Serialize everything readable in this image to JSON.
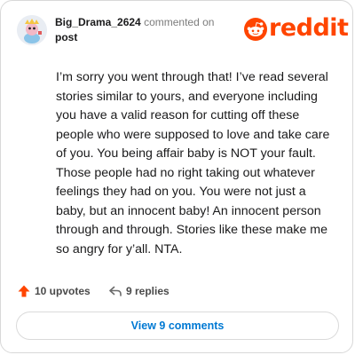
{
  "comment": {
    "username": "Big_Drama_2624",
    "action_text": "commented on",
    "post_type": "post",
    "body": "I’m sorry you went through that! I’ve read several\nstories similar to yours, and everyone including\nyou have a valid reason for cutting off these\npeople who were supposed to love and take care\nof you. You being affair baby is NOT your fault.\nThose people had no right taking out whatever\nfeelings they had on you. You were not just a\nbaby, but an innocent baby! An innocent person\nthrough and through. Stories like these make me\nso angry for y’all. NTA."
  },
  "brand": {
    "name": "reddit",
    "color": "#ff4500"
  },
  "stats": {
    "upvotes": "10 upvotes",
    "replies": "9 replies"
  },
  "actions": {
    "view_comments": "View 9 comments"
  },
  "icons": {
    "avatar": "avatar",
    "logo": "reddit-alien-icon",
    "upvote": "upvote-arrow-icon",
    "reply": "reply-icon"
  }
}
